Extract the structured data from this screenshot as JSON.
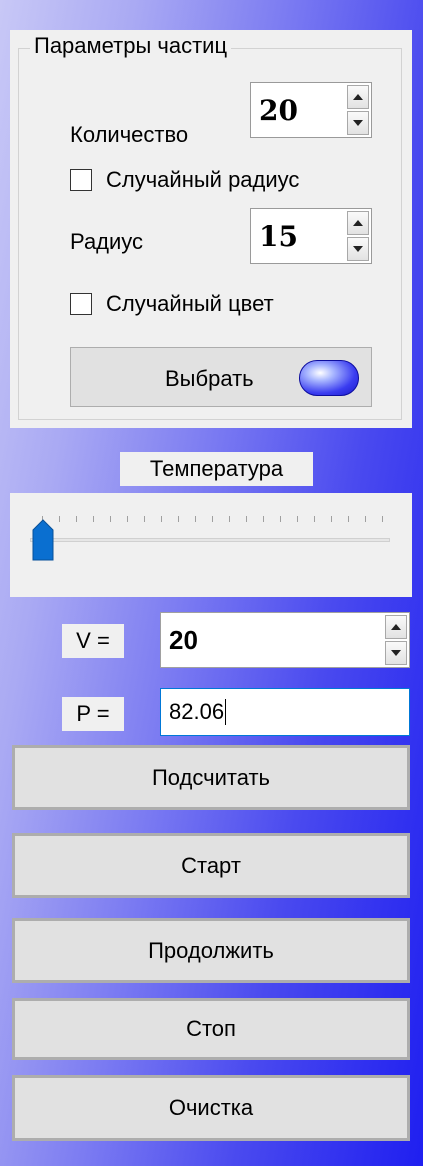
{
  "particle_params": {
    "title": "Параметры частиц",
    "count_label": "Количество",
    "count_value": "20",
    "random_radius_label": "Случайный радиус",
    "random_radius_checked": false,
    "radius_label": "Радиус",
    "radius_value": "15",
    "random_color_label": "Случайный цвет",
    "random_color_checked": false,
    "choose_button_label": "Выбрать",
    "particle_color": "#3a3cf0"
  },
  "temperature": {
    "title": "Температура",
    "slider_position_percent": 0
  },
  "volume": {
    "label": "V =",
    "value": "20"
  },
  "pressure": {
    "label": "P =",
    "value": "82.06"
  },
  "buttons": {
    "calculate": "Подсчитать",
    "start": "Старт",
    "continue": "Продолжить",
    "stop": "Стоп",
    "clear": "Очистка"
  }
}
